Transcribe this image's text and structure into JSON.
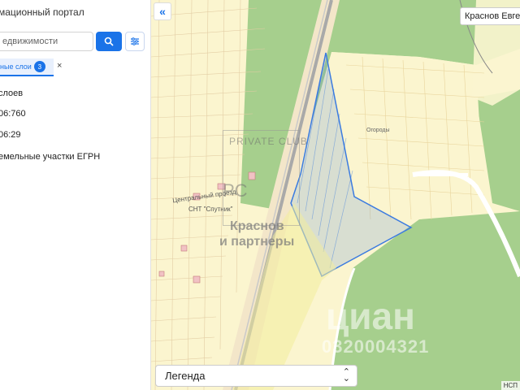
{
  "sidebar": {
    "portal_title": "мационный портал",
    "search": {
      "value": "едвижимости"
    },
    "layers_chip": {
      "label": "ные слои",
      "count": "3",
      "close": "×"
    },
    "lines": [
      "слоев",
      "06:760",
      "06:29",
      "емельные участки ЕГРН"
    ]
  },
  "map": {
    "user_button": "Краснов Евгени",
    "legend_label": "Легенда",
    "watermark": {
      "club": "PRIVATE CLUB",
      "monogram": "PC",
      "line1": "Краснов",
      "line2": "и партнеры",
      "cian": "циан",
      "cian_id": "0320004321"
    },
    "labels": {
      "central_passage": "Центральный проезд",
      "snt": "СНТ \"Спутник\"",
      "street_small": "Огороды"
    },
    "corner_text": "НСП"
  },
  "colors": {
    "accent": "#1a73e8",
    "forest": "#a6cf8d",
    "plot_fill": "#fbf5cf",
    "highlight": "#3b7be0"
  },
  "icons": {
    "search": "search-icon",
    "filter": "filter-icon",
    "collapse": "double-chevron-left-icon",
    "legend_toggle": "chevron-up-down-icon"
  }
}
